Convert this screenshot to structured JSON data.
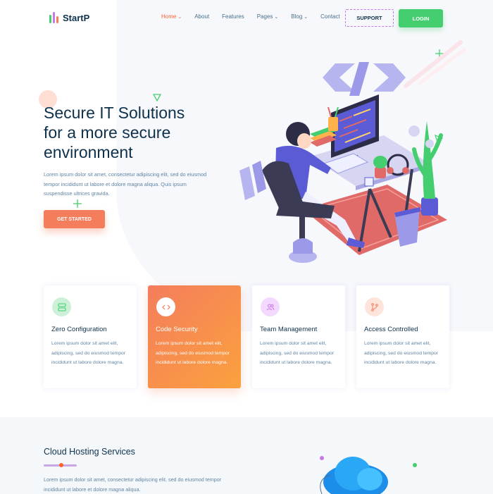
{
  "brand": {
    "name": "StartP",
    "colors": {
      "green": "#44ce6f",
      "orange": "#f47d5c",
      "purple": "#c679e3",
      "navy": "#0e314c"
    }
  },
  "nav": {
    "items": [
      {
        "label": "Home",
        "has_dropdown": true,
        "active": true
      },
      {
        "label": "About",
        "has_dropdown": false
      },
      {
        "label": "Features",
        "has_dropdown": false
      },
      {
        "label": "Pages",
        "has_dropdown": true
      },
      {
        "label": "Blog",
        "has_dropdown": true
      },
      {
        "label": "Contact",
        "has_dropdown": false
      }
    ],
    "caret": "⌄",
    "support_label": "SUPPORT",
    "login_label": "LOGIN"
  },
  "hero": {
    "title_lines": [
      "Secure IT Solutions",
      "for a more secure",
      "environment"
    ],
    "text": "Lorem ipsum dolor sit amet, consectetur adipiscing elit, sed do eiusmod tempor incididunt ut labore et dolore magna aliqua. Quis ipsum suspendisse ultrices gravida.",
    "cta_label": "GET STARTED"
  },
  "features": [
    {
      "title": "Zero Configuration",
      "icon": "server-icon",
      "featured": false,
      "icon_bg": "#cdf1d8",
      "icon_color": "#44ce6f",
      "text": "Lorem ipsum dolor sit amet elit, adipiscing, sed do eiusmod tempor incididunt ut labore dolore magna."
    },
    {
      "title": "Code Security",
      "icon": "code-icon",
      "featured": true,
      "icon_bg": "#ffffff",
      "icon_color": "#f47d5c",
      "text": "Lorem ipsum dolor sit amet elit, adipiscing, sed do eiusmod tempor incididunt ut labore dolore magna."
    },
    {
      "title": "Team Management",
      "icon": "users-icon",
      "featured": false,
      "icon_bg": "#f3d8ff",
      "icon_color": "#c679e3",
      "text": "Lorem ipsum dolor sit amet elit, adipiscing, sed do eiusmod tempor incididunt ut labore dolore magna."
    },
    {
      "title": "Access Controlled",
      "icon": "git-branch-icon",
      "featured": false,
      "icon_bg": "#ffe4dc",
      "icon_color": "#f47d5c",
      "text": "Lorem ipsum dolor sit amet elit, adipiscing, sed do eiusmod tempor incididunt ut labore dolore magna."
    }
  ],
  "cloud": {
    "title": "Cloud Hosting Services",
    "text": "Lorem ipsum dolor sit amet, consectetur adipiscing elit, sed do eiusmod tempor incididunt ut labore et dolore magna aliqua."
  }
}
